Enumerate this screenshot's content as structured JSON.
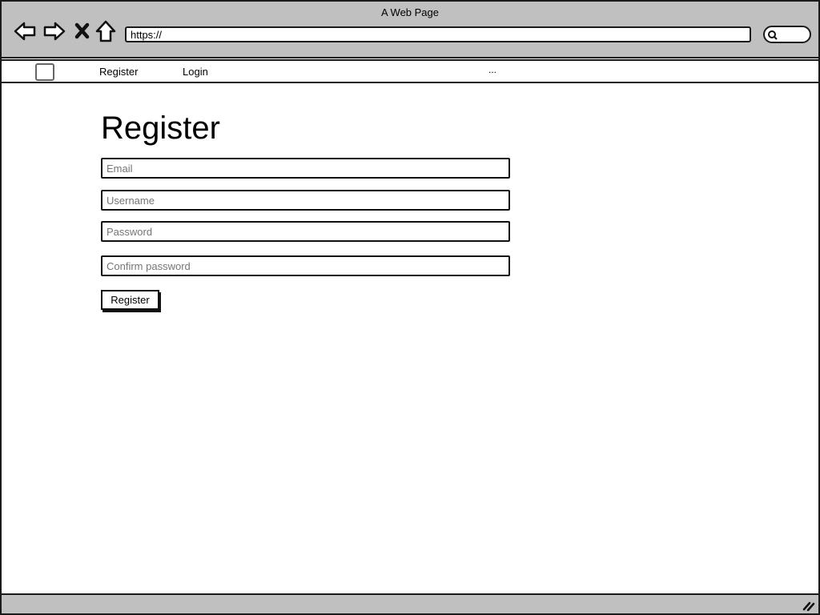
{
  "window": {
    "title": "A Web Page"
  },
  "browser": {
    "url": "https://",
    "icons": [
      "back-arrow-icon",
      "forward-arrow-icon",
      "close-x-icon",
      "home-icon",
      "search-icon"
    ]
  },
  "menu": {
    "items": [
      {
        "label": "Register"
      },
      {
        "label": "Login"
      }
    ],
    "more": "..."
  },
  "page": {
    "heading": "Register",
    "fields": [
      {
        "placeholder": "Email"
      },
      {
        "placeholder": "Username"
      },
      {
        "placeholder": "Password"
      },
      {
        "placeholder": "Confirm password"
      }
    ],
    "submit_label": "Register"
  }
}
